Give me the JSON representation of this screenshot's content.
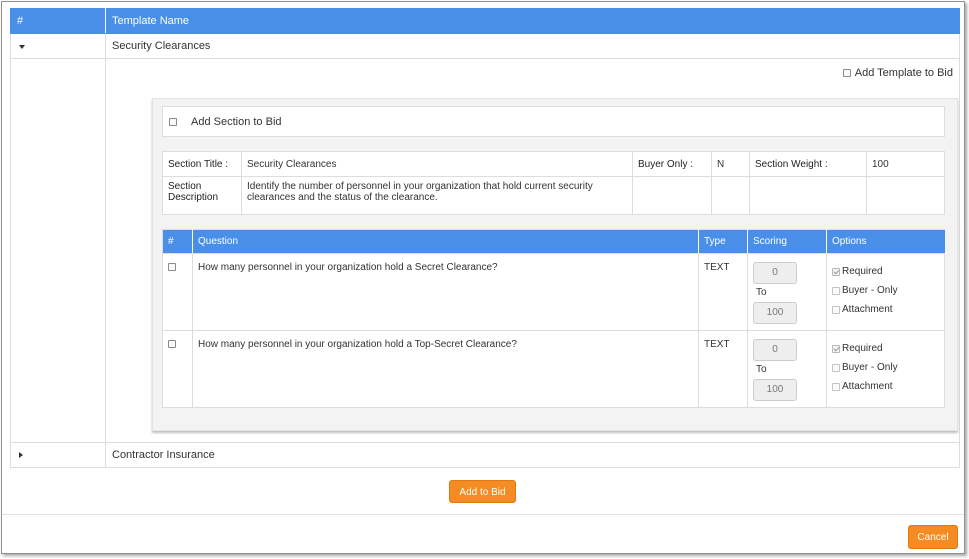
{
  "templates_table": {
    "columns": [
      "#",
      "Template Name"
    ],
    "rows": [
      {
        "name": "Security Clearances",
        "expanded": true
      },
      {
        "name": "Contractor Insurance",
        "expanded": false
      }
    ]
  },
  "add_template_label": "Add Template to Bid",
  "section": {
    "add_section_label": "Add Section to Bid",
    "title_label": "Section Title :",
    "title": "Security Clearances",
    "buyer_only_label": "Buyer Only :",
    "buyer_only": "N",
    "weight_label": "Section Weight :",
    "weight": "100",
    "description_label": "Section Description",
    "description": "Identify the number of personnel in your organization that hold current security clearances and the status of the clearance."
  },
  "questions_table": {
    "columns": [
      "#",
      "Question",
      "Type",
      "Scoring",
      "Options"
    ],
    "to_label": "To",
    "options_labels": [
      "Required",
      "Buyer - Only",
      "Attachment"
    ],
    "rows": [
      {
        "question": "How many personnel in your organization hold a Secret Clearance?",
        "type": "TEXT",
        "score_min": "0",
        "score_max": "100",
        "required": true,
        "buyer_only": false,
        "attachment": false
      },
      {
        "question": "How many personnel in your organization hold a Top-Secret Clearance?",
        "type": "TEXT",
        "score_min": "0",
        "score_max": "100",
        "required": true,
        "buyer_only": false,
        "attachment": false
      }
    ]
  },
  "buttons": {
    "add_to_bid": "Add to Bid",
    "cancel": "Cancel"
  },
  "colors": {
    "header_blue": "#4a8fe7",
    "button_orange": "#f58b23"
  }
}
